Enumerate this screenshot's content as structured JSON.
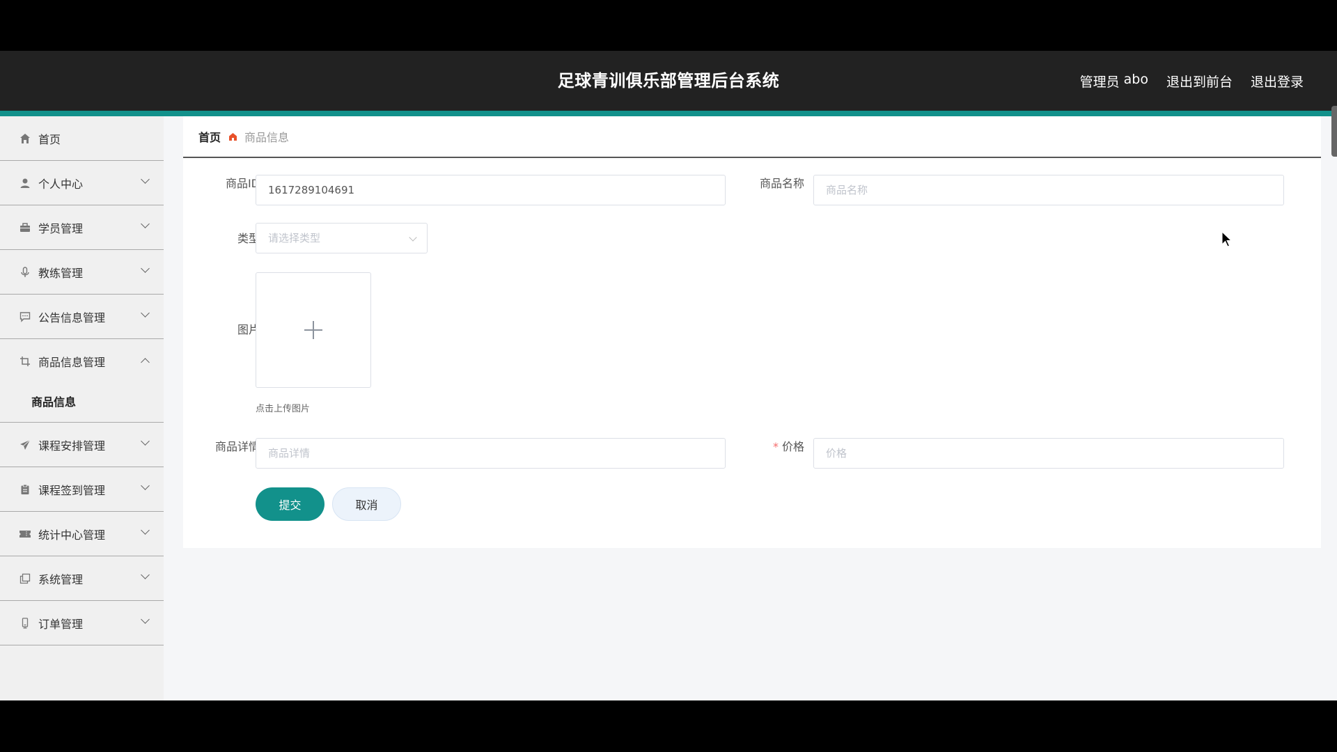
{
  "header": {
    "title": "足球青训俱乐部管理后台系统",
    "user_role": "管理员",
    "user_name": "abo",
    "to_front": "退出到前台",
    "logout": "退出登录"
  },
  "sidebar": {
    "items": [
      {
        "label": "首页",
        "icon": "home-icon",
        "expanded": false
      },
      {
        "label": "个人中心",
        "icon": "user-icon",
        "expanded": false
      },
      {
        "label": "学员管理",
        "icon": "briefcase-icon",
        "expanded": false
      },
      {
        "label": "教练管理",
        "icon": "microphone-icon",
        "expanded": false
      },
      {
        "label": "公告信息管理",
        "icon": "chat-icon",
        "expanded": false
      },
      {
        "label": "商品信息管理",
        "icon": "crop-icon",
        "expanded": true
      },
      {
        "label": "课程安排管理",
        "icon": "send-icon",
        "expanded": false
      },
      {
        "label": "课程签到管理",
        "icon": "clipboard-icon",
        "expanded": false
      },
      {
        "label": "统计中心管理",
        "icon": "ticket-icon",
        "expanded": false
      },
      {
        "label": "系统管理",
        "icon": "copy-icon",
        "expanded": false
      },
      {
        "label": "订单管理",
        "icon": "phone-icon",
        "expanded": false
      }
    ],
    "sub_items": {
      "product": [
        "商品信息"
      ]
    }
  },
  "breadcrumb": {
    "home": "首页",
    "separator_icon": "home-pentagon-icon",
    "current": "商品信息"
  },
  "form": {
    "product_id": {
      "label": "商品ID",
      "value": "1617289104691"
    },
    "product_name": {
      "label": "商品名称",
      "placeholder": "商品名称",
      "value": ""
    },
    "type": {
      "label": "类型",
      "placeholder": "请选择类型"
    },
    "image": {
      "label": "图片",
      "hint": "点击上传图片"
    },
    "details": {
      "label": "商品详情",
      "placeholder": "商品详情"
    },
    "price": {
      "label": "价格",
      "required_mark": "*",
      "placeholder": "价格"
    },
    "submit": "提交",
    "cancel": "取消"
  },
  "colors": {
    "accent": "#12918b",
    "header_bg": "#222222",
    "sidebar_bg": "#f0f0f0"
  }
}
